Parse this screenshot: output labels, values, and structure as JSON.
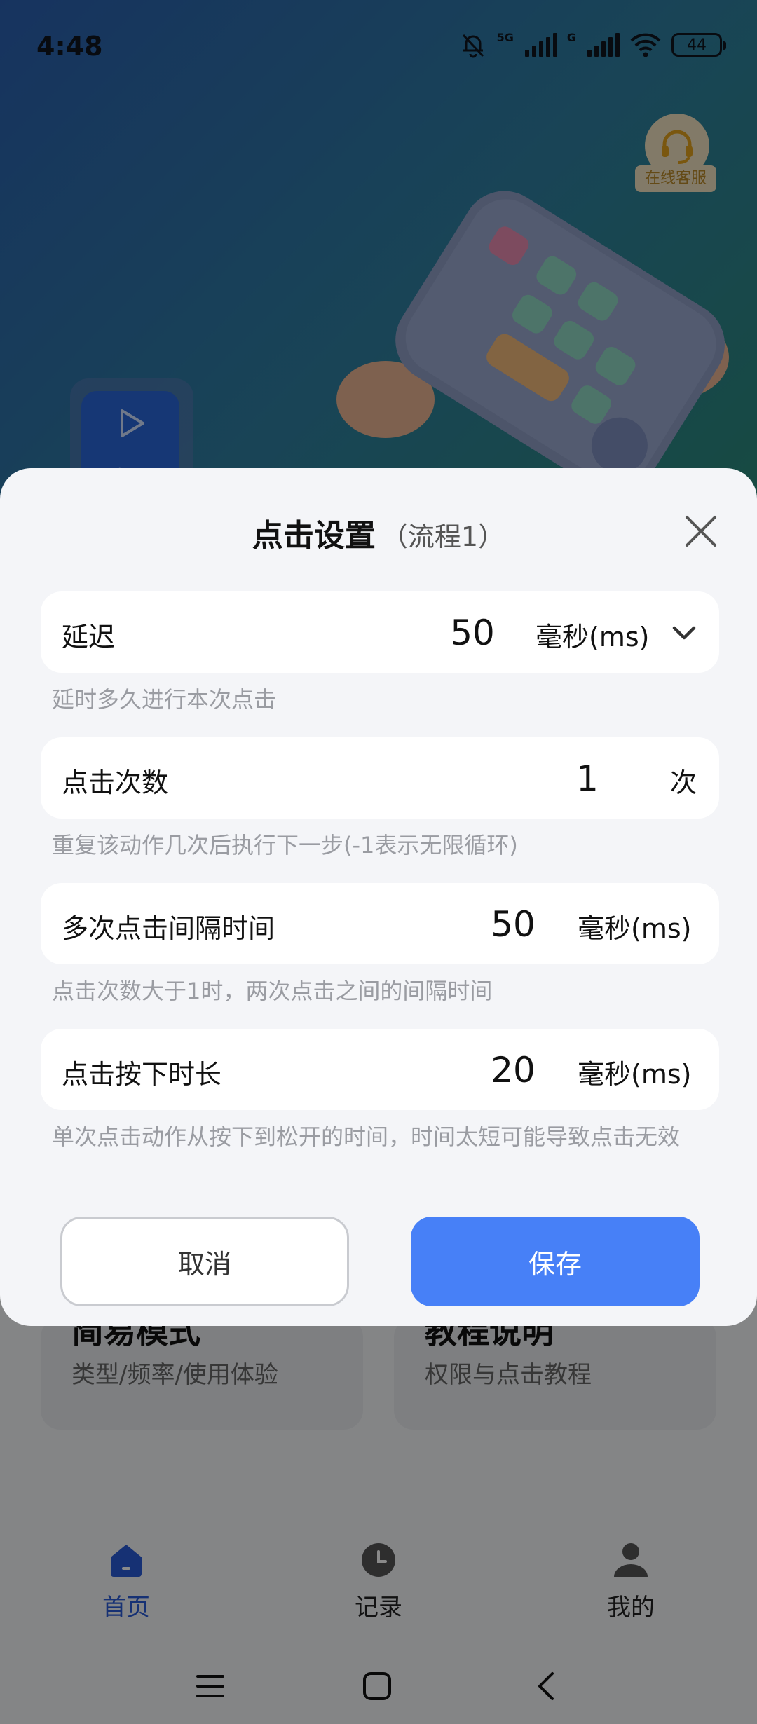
{
  "status_bar": {
    "time": "4:48",
    "sig1_label": "5G",
    "sig2_label": "G",
    "battery": "44"
  },
  "background": {
    "service_label": "在线客服",
    "start_label": "启动",
    "cards": [
      {
        "title": "简易模式",
        "subtitle": "类型/频率/使用体验"
      },
      {
        "title": "教程说明",
        "subtitle": "权限与点击教程"
      }
    ],
    "tabs": [
      {
        "label": "首页",
        "active": true
      },
      {
        "label": "记录",
        "active": false
      },
      {
        "label": "我的",
        "active": false
      }
    ]
  },
  "dialog": {
    "title": "点击设置",
    "subtitle": "（流程1）",
    "rows": [
      {
        "label": "延迟",
        "value": "50",
        "unit": "毫秒(ms)",
        "hint": "延时多久进行本次点击"
      },
      {
        "label": "点击次数",
        "value": "1",
        "unit": "次",
        "hint": "重复该动作几次后执行下一步(-1表示无限循环)"
      },
      {
        "label": "多次点击间隔时间",
        "value": "50",
        "unit": "毫秒(ms)",
        "hint": "点击次数大于1时，两次点击之间的间隔时间"
      },
      {
        "label": "点击按下时长",
        "value": "20",
        "unit": "毫秒(ms)",
        "hint": "单次点击动作从按下到松开的时间，时间太短可能导致点击无效"
      }
    ],
    "cancel_label": "取消",
    "save_label": "保存"
  },
  "colors": {
    "accent": "#4780f7",
    "tab_active": "#2a5bd7",
    "service": "#b98a2a"
  }
}
